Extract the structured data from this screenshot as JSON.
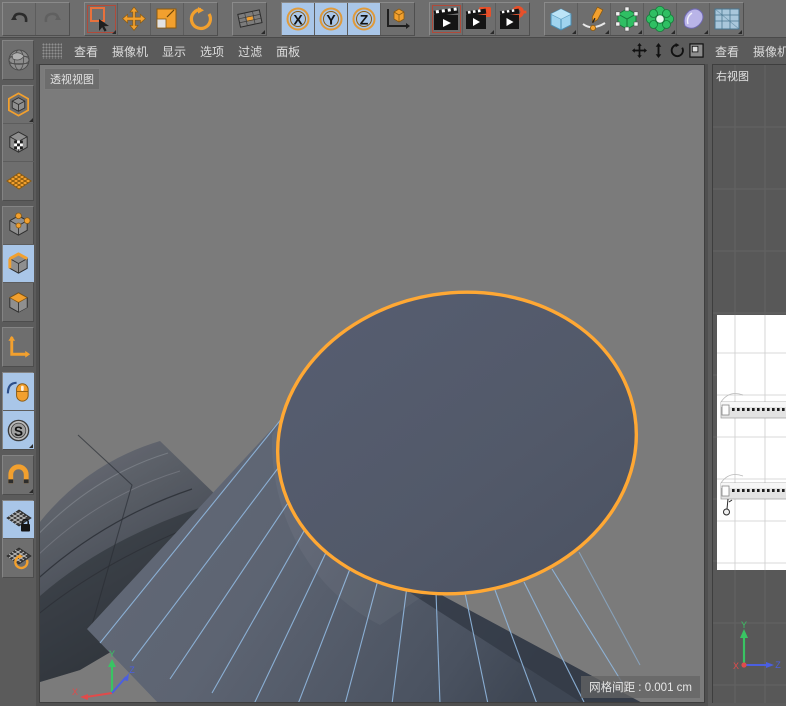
{
  "app": {
    "name": "Cinema 4D",
    "accent_orange": "#f7a623",
    "selection_orange": "#ffa834",
    "wireframe_blue": "#8ab4dd",
    "viewport_bg": "#7b7b7b",
    "panel_bg": "#6e6e6e",
    "active_blue": "#a9c6e8"
  },
  "top_toolbar": {
    "groups": [
      {
        "name": "history",
        "buttons": [
          {
            "name": "undo-button",
            "icon": "undo-arrow-icon",
            "label": "撤销",
            "state": "normal",
            "has_corner": false
          },
          {
            "name": "redo-button",
            "icon": "redo-arrow-icon",
            "label": "重做",
            "state": "disabled",
            "has_corner": false
          }
        ]
      },
      {
        "name": "transform-tools",
        "buttons": [
          {
            "name": "live-selection-button",
            "icon": "live-selection-icon",
            "label": "实时选择",
            "state": "selected",
            "has_corner": true
          },
          {
            "name": "move-button",
            "icon": "move-icon",
            "label": "移动",
            "state": "normal",
            "has_corner": false
          },
          {
            "name": "scale-button",
            "icon": "scale-icon",
            "label": "缩放",
            "state": "normal",
            "has_corner": false
          },
          {
            "name": "rotate-button",
            "icon": "rotate-icon",
            "label": "旋转",
            "state": "normal",
            "has_corner": false
          }
        ]
      },
      {
        "name": "workplane",
        "buttons": [
          {
            "name": "workplane-button",
            "icon": "workplane-icon",
            "label": "工作平面",
            "state": "normal",
            "has_corner": true
          }
        ]
      },
      {
        "name": "axis-locks",
        "buttons": [
          {
            "name": "lock-x-button",
            "icon": "axis-x-icon",
            "label": "X",
            "state": "active",
            "has_corner": false
          },
          {
            "name": "lock-y-button",
            "icon": "axis-y-icon",
            "label": "Y",
            "state": "active",
            "has_corner": false
          },
          {
            "name": "lock-z-button",
            "icon": "axis-z-icon",
            "label": "Z",
            "state": "active",
            "has_corner": false
          },
          {
            "name": "world-object-coord-button",
            "icon": "world-coordinate-icon",
            "label": "世界坐标",
            "state": "normal",
            "has_corner": false
          }
        ]
      },
      {
        "name": "render",
        "buttons": [
          {
            "name": "render-view-button",
            "icon": "render-view-icon",
            "label": "渲染当前视图",
            "state": "selected",
            "has_corner": false
          },
          {
            "name": "render-picture-viewer-button",
            "icon": "render-picture-viewer-icon",
            "label": "渲染到图片查看器",
            "state": "normal",
            "has_corner": true
          },
          {
            "name": "render-settings-button",
            "icon": "render-settings-icon",
            "label": "编辑渲染设置",
            "state": "normal",
            "has_corner": false
          }
        ]
      },
      {
        "name": "create",
        "buttons": [
          {
            "name": "add-primitive-button",
            "icon": "cube-primitive-icon",
            "label": "立方体",
            "state": "normal",
            "has_corner": true
          },
          {
            "name": "add-spline-button",
            "icon": "spline-pen-icon",
            "label": "样条画笔",
            "state": "normal",
            "has_corner": true
          },
          {
            "name": "add-generator-button",
            "icon": "generator-icon",
            "label": "生成器",
            "state": "normal",
            "has_corner": true
          },
          {
            "name": "add-deformer-button",
            "icon": "deformer-icon",
            "label": "变形器",
            "state": "normal",
            "has_corner": true
          },
          {
            "name": "add-scene-object-button",
            "icon": "environment-icon",
            "label": "场景",
            "state": "normal",
            "has_corner": true
          },
          {
            "name": "add-camera-button",
            "icon": "camera-grid-icon",
            "label": "摄像机",
            "state": "normal",
            "has_corner": true
          }
        ]
      }
    ]
  },
  "left_toolbar": {
    "groups": [
      {
        "name": "texture-group",
        "buttons": [
          {
            "name": "tool-texture-axis",
            "icon": "globe-texture-icon",
            "label": "纹理轴",
            "state": "normal"
          }
        ]
      },
      {
        "name": "mode-group",
        "buttons": [
          {
            "name": "tool-object-mode",
            "icon": "object-mode-cube-icon",
            "label": "模型",
            "state": "normal",
            "has_corner": true
          },
          {
            "name": "tool-texture-mode",
            "icon": "texture-mode-icon",
            "label": "纹理",
            "state": "normal"
          },
          {
            "name": "tool-workplane-mode",
            "icon": "workplane-grid-icon",
            "label": "工作平面",
            "state": "normal"
          }
        ]
      },
      {
        "name": "component-group",
        "buttons": [
          {
            "name": "tool-point-mode",
            "icon": "point-mode-icon",
            "label": "点模式",
            "state": "normal"
          },
          {
            "name": "tool-edge-mode",
            "icon": "edge-mode-icon",
            "label": "边模式",
            "state": "active"
          },
          {
            "name": "tool-polygon-mode",
            "icon": "polygon-mode-icon",
            "label": "多边形模式",
            "state": "normal"
          }
        ]
      },
      {
        "name": "axis-group",
        "buttons": [
          {
            "name": "tool-enable-axis",
            "icon": "axis-modify-icon",
            "label": "启用轴心",
            "state": "normal"
          }
        ]
      },
      {
        "name": "selection-group",
        "buttons": [
          {
            "name": "tool-viewport-solo",
            "icon": "mouse-axis-icon",
            "label": "视窗单体独显",
            "state": "active"
          },
          {
            "name": "tool-soft-selection",
            "icon": "soft-selection-icon",
            "label": "衰减",
            "state": "active",
            "has_corner": true
          }
        ]
      },
      {
        "name": "snap-group",
        "buttons": [
          {
            "name": "tool-snap",
            "icon": "magnet-snap-icon",
            "label": "捕捉",
            "state": "normal",
            "has_corner": true
          }
        ]
      },
      {
        "name": "workplane-group",
        "buttons": [
          {
            "name": "tool-lock-workplane",
            "icon": "lock-workplane-icon",
            "label": "锁定工作平面",
            "state": "active"
          },
          {
            "name": "tool-planar-workplane",
            "icon": "planar-workplane-icon",
            "label": "工作平面模式",
            "state": "normal"
          }
        ]
      }
    ]
  },
  "perspective_viewport": {
    "menu_items": [
      {
        "name": "menu-view",
        "label": "查看"
      },
      {
        "name": "menu-camera",
        "label": "摄像机"
      },
      {
        "name": "menu-display",
        "label": "显示"
      },
      {
        "name": "menu-options",
        "label": "选项"
      },
      {
        "name": "menu-filter",
        "label": "过滤"
      },
      {
        "name": "menu-panel",
        "label": "面板"
      }
    ],
    "nav_buttons": [
      {
        "name": "viewport-pan-button",
        "icon": "pan-move-icon",
        "label": "移动视图"
      },
      {
        "name": "viewport-zoom-button",
        "icon": "zoom-vertical-icon",
        "label": "缩放视图"
      },
      {
        "name": "viewport-rotate-button",
        "icon": "rotate-view-icon",
        "label": "旋转视图"
      },
      {
        "name": "viewport-maximize-button",
        "icon": "maximize-viewport-icon",
        "label": "最大化视图"
      }
    ],
    "label": "透视视图",
    "grid_readout": "网格间距 : 0.001 cm",
    "axis_gizmo": {
      "x": "X",
      "y": "Y",
      "z": "Z"
    },
    "scene": {
      "selected_element": "圆形边线",
      "cap_fill_color": "#545b6e",
      "cap_outline_color": "#ffa834",
      "body_color": "#5a6170",
      "wire_color": "#8fb6dd",
      "background_color": "#7b7b7b"
    }
  },
  "right_viewport": {
    "menu_items": [
      {
        "name": "menu-view-right",
        "label": "查看"
      },
      {
        "name": "menu-camera-right",
        "label": "摄像机"
      }
    ],
    "label": "右视图",
    "axis_gizmo": {
      "x": "X",
      "y": "Y",
      "z": "Z"
    },
    "reference_image": "飞机机身蓝图"
  }
}
